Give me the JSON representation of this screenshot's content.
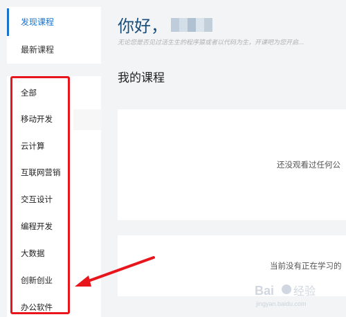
{
  "sidebar": {
    "top_items": [
      {
        "label": "发现课程",
        "active": true
      },
      {
        "label": "最新课程",
        "active": false
      }
    ],
    "categories": [
      "全部",
      "移动开发",
      "云计算",
      "互联网营销",
      "交互设计",
      "编程开发",
      "大数据",
      "创新创业",
      "办公软件"
    ]
  },
  "main": {
    "greeting": "你好，",
    "subtitle": "无论您是否见过活生生的程序猿或者以代码为生，开课吧为您开启...",
    "section_title": "我的课程",
    "empty_watched": "还没观看过任何公",
    "empty_learning": "当前没有正在学习的"
  },
  "watermark": {
    "logo_text": "Bai",
    "logo_text2": "经验",
    "url": "jingyan.baidu.com"
  },
  "colors": {
    "accent": "#1a73c8",
    "annotation_red": "#e8161c",
    "greeting": "#1a4f7c"
  }
}
